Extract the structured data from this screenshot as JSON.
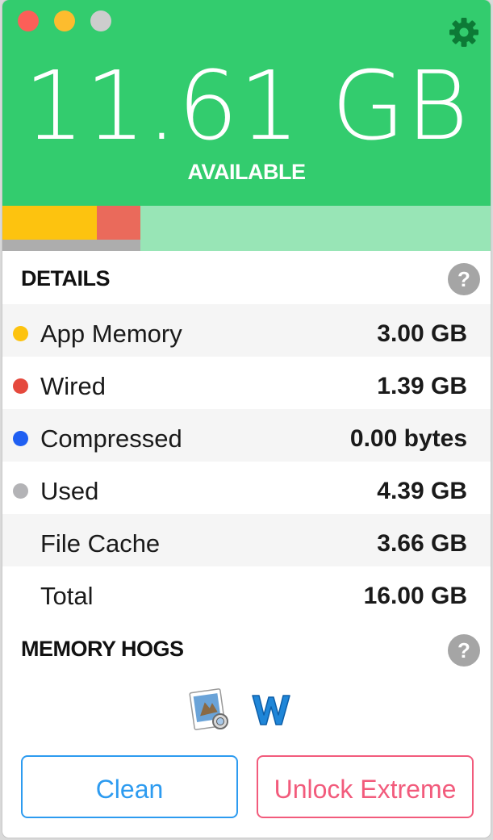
{
  "header": {
    "available_value": "11.61 GB",
    "available_label": "AVAILABLE",
    "background_color": "#33cc6e"
  },
  "window_controls": {
    "close_color": "#fc5f58",
    "minimize_color": "#fdbc2e",
    "zoom_color": "#cdcdcd"
  },
  "settings": {
    "icon": "gear-icon"
  },
  "usage_bar": {
    "app_memory_fraction": 0.1875,
    "wired_fraction": 0.0869,
    "used_fraction": 0.2744,
    "colors": {
      "app_memory": "#fdc30f",
      "wired": "#ea6a5b",
      "used": "#adadad",
      "free": "#98e5b6"
    }
  },
  "details": {
    "title": "DETAILS",
    "help_label": "?",
    "rows": [
      {
        "label": "App Memory",
        "value": "3.00 GB",
        "color": "#fdc30f"
      },
      {
        "label": "Wired",
        "value": "1.39 GB",
        "color": "#e5493d"
      },
      {
        "label": "Compressed",
        "value": "0.00 bytes",
        "color": "#1f5ff2"
      },
      {
        "label": "Used",
        "value": "4.39 GB",
        "color": "#b3b3b6"
      },
      {
        "label": "File Cache",
        "value": "3.66 GB"
      },
      {
        "label": "Total",
        "value": "16.00 GB"
      }
    ]
  },
  "memory_hogs": {
    "title": "MEMORY HOGS",
    "help_label": "?",
    "apps": [
      {
        "icon": "preview-app-icon"
      },
      {
        "icon": "word-app-icon"
      }
    ]
  },
  "buttons": {
    "clean_label": "Clean",
    "extreme_label": "Unlock Extreme",
    "clean_color": "#2d9bf0",
    "extreme_color": "#f25b7c"
  }
}
